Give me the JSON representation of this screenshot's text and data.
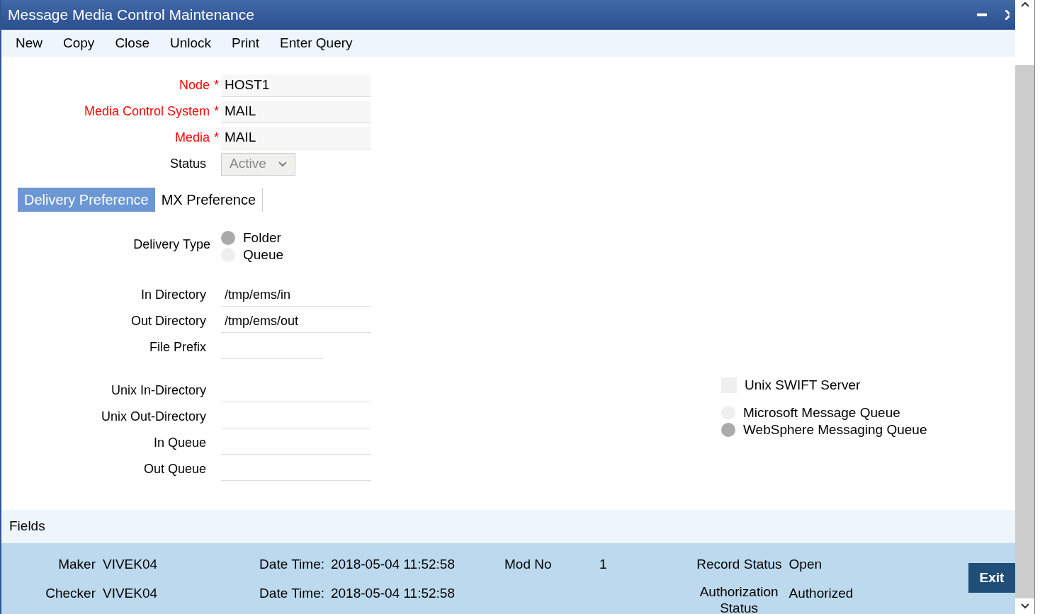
{
  "window": {
    "title": "Message Media Control Maintenance"
  },
  "toolbar": [
    "New",
    "Copy",
    "Close",
    "Unlock",
    "Print",
    "Enter Query"
  ],
  "header_fields": [
    {
      "label": "Node",
      "mark": "*",
      "value": "HOST1"
    },
    {
      "label": "Media Control System",
      "mark": "*",
      "value": "MAIL"
    },
    {
      "label": "Media",
      "mark": "*",
      "value": "MAIL"
    }
  ],
  "status": {
    "label": "Status",
    "value": "Active",
    "disabled": true
  },
  "tabs": [
    {
      "label": "Delivery Preference",
      "selected": true
    },
    {
      "label": "MX Preference",
      "selected": false
    }
  ],
  "delivery_type": {
    "label": "Delivery Type",
    "options": [
      {
        "label": "Folder",
        "selected": true
      },
      {
        "label": "Queue",
        "selected": false
      }
    ]
  },
  "directory_fields": [
    {
      "label": "In Directory",
      "value": "/tmp/ems/in",
      "kind": "wide"
    },
    {
      "label": "Out Directory",
      "value": "/tmp/ems/out",
      "kind": "wide"
    },
    {
      "label": "File Prefix",
      "kind": "short"
    }
  ],
  "unix_fields": [
    {
      "label": "Unix In-Directory"
    },
    {
      "label": "Unix Out-Directory"
    },
    {
      "label": "In Queue"
    },
    {
      "label": "Out Queue"
    }
  ],
  "unix_swift_server": {
    "label": "Unix SWIFT Server",
    "checked": false
  },
  "queue_options": [
    {
      "label": "Microsoft Message Queue",
      "selected": false
    },
    {
      "label": "WebSphere Messaging Queue",
      "selected": true
    }
  ],
  "fields_section": {
    "title": "Fields"
  },
  "audit": {
    "maker": {
      "label": "Maker",
      "value": "VIVEK04"
    },
    "checker": {
      "label": "Checker",
      "value": "VIVEK04"
    },
    "maker_date": {
      "label": "Date Time:",
      "value": "2018-05-04 11:52:58"
    },
    "checker_date": {
      "label": "Date Time:",
      "value": "2018-05-04 11:52:58"
    },
    "mod_no": {
      "label": "Mod No",
      "value": "1"
    },
    "record_status": {
      "label": "Record Status",
      "value": "Open"
    },
    "authorization_status": {
      "label": "Authorization Status",
      "value": "Authorized"
    }
  },
  "exit_button": "Exit"
}
